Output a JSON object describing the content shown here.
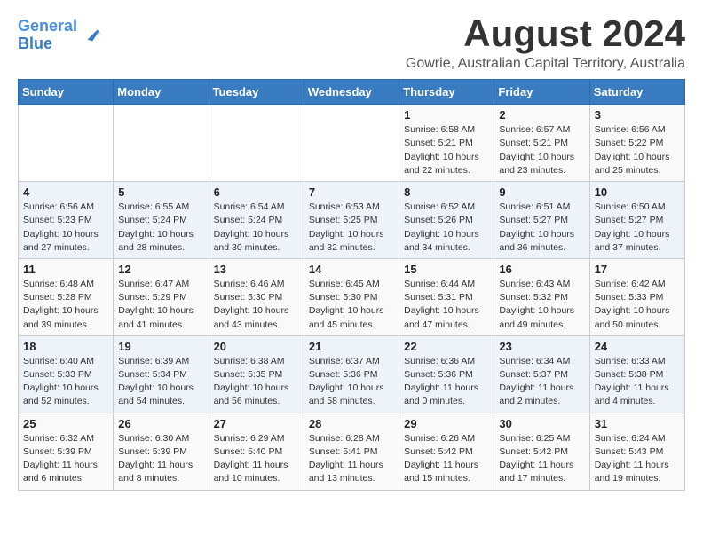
{
  "logo": {
    "line1": "General",
    "line2": "Blue"
  },
  "title": "August 2024",
  "location": "Gowrie, Australian Capital Territory, Australia",
  "weekdays": [
    "Sunday",
    "Monday",
    "Tuesday",
    "Wednesday",
    "Thursday",
    "Friday",
    "Saturday"
  ],
  "weeks": [
    [
      {
        "day": "",
        "info": ""
      },
      {
        "day": "",
        "info": ""
      },
      {
        "day": "",
        "info": ""
      },
      {
        "day": "",
        "info": ""
      },
      {
        "day": "1",
        "info": "Sunrise: 6:58 AM\nSunset: 5:21 PM\nDaylight: 10 hours\nand 22 minutes."
      },
      {
        "day": "2",
        "info": "Sunrise: 6:57 AM\nSunset: 5:21 PM\nDaylight: 10 hours\nand 23 minutes."
      },
      {
        "day": "3",
        "info": "Sunrise: 6:56 AM\nSunset: 5:22 PM\nDaylight: 10 hours\nand 25 minutes."
      }
    ],
    [
      {
        "day": "4",
        "info": "Sunrise: 6:56 AM\nSunset: 5:23 PM\nDaylight: 10 hours\nand 27 minutes."
      },
      {
        "day": "5",
        "info": "Sunrise: 6:55 AM\nSunset: 5:24 PM\nDaylight: 10 hours\nand 28 minutes."
      },
      {
        "day": "6",
        "info": "Sunrise: 6:54 AM\nSunset: 5:24 PM\nDaylight: 10 hours\nand 30 minutes."
      },
      {
        "day": "7",
        "info": "Sunrise: 6:53 AM\nSunset: 5:25 PM\nDaylight: 10 hours\nand 32 minutes."
      },
      {
        "day": "8",
        "info": "Sunrise: 6:52 AM\nSunset: 5:26 PM\nDaylight: 10 hours\nand 34 minutes."
      },
      {
        "day": "9",
        "info": "Sunrise: 6:51 AM\nSunset: 5:27 PM\nDaylight: 10 hours\nand 36 minutes."
      },
      {
        "day": "10",
        "info": "Sunrise: 6:50 AM\nSunset: 5:27 PM\nDaylight: 10 hours\nand 37 minutes."
      }
    ],
    [
      {
        "day": "11",
        "info": "Sunrise: 6:48 AM\nSunset: 5:28 PM\nDaylight: 10 hours\nand 39 minutes."
      },
      {
        "day": "12",
        "info": "Sunrise: 6:47 AM\nSunset: 5:29 PM\nDaylight: 10 hours\nand 41 minutes."
      },
      {
        "day": "13",
        "info": "Sunrise: 6:46 AM\nSunset: 5:30 PM\nDaylight: 10 hours\nand 43 minutes."
      },
      {
        "day": "14",
        "info": "Sunrise: 6:45 AM\nSunset: 5:30 PM\nDaylight: 10 hours\nand 45 minutes."
      },
      {
        "day": "15",
        "info": "Sunrise: 6:44 AM\nSunset: 5:31 PM\nDaylight: 10 hours\nand 47 minutes."
      },
      {
        "day": "16",
        "info": "Sunrise: 6:43 AM\nSunset: 5:32 PM\nDaylight: 10 hours\nand 49 minutes."
      },
      {
        "day": "17",
        "info": "Sunrise: 6:42 AM\nSunset: 5:33 PM\nDaylight: 10 hours\nand 50 minutes."
      }
    ],
    [
      {
        "day": "18",
        "info": "Sunrise: 6:40 AM\nSunset: 5:33 PM\nDaylight: 10 hours\nand 52 minutes."
      },
      {
        "day": "19",
        "info": "Sunrise: 6:39 AM\nSunset: 5:34 PM\nDaylight: 10 hours\nand 54 minutes."
      },
      {
        "day": "20",
        "info": "Sunrise: 6:38 AM\nSunset: 5:35 PM\nDaylight: 10 hours\nand 56 minutes."
      },
      {
        "day": "21",
        "info": "Sunrise: 6:37 AM\nSunset: 5:36 PM\nDaylight: 10 hours\nand 58 minutes."
      },
      {
        "day": "22",
        "info": "Sunrise: 6:36 AM\nSunset: 5:36 PM\nDaylight: 11 hours\nand 0 minutes."
      },
      {
        "day": "23",
        "info": "Sunrise: 6:34 AM\nSunset: 5:37 PM\nDaylight: 11 hours\nand 2 minutes."
      },
      {
        "day": "24",
        "info": "Sunrise: 6:33 AM\nSunset: 5:38 PM\nDaylight: 11 hours\nand 4 minutes."
      }
    ],
    [
      {
        "day": "25",
        "info": "Sunrise: 6:32 AM\nSunset: 5:39 PM\nDaylight: 11 hours\nand 6 minutes."
      },
      {
        "day": "26",
        "info": "Sunrise: 6:30 AM\nSunset: 5:39 PM\nDaylight: 11 hours\nand 8 minutes."
      },
      {
        "day": "27",
        "info": "Sunrise: 6:29 AM\nSunset: 5:40 PM\nDaylight: 11 hours\nand 10 minutes."
      },
      {
        "day": "28",
        "info": "Sunrise: 6:28 AM\nSunset: 5:41 PM\nDaylight: 11 hours\nand 13 minutes."
      },
      {
        "day": "29",
        "info": "Sunrise: 6:26 AM\nSunset: 5:42 PM\nDaylight: 11 hours\nand 15 minutes."
      },
      {
        "day": "30",
        "info": "Sunrise: 6:25 AM\nSunset: 5:42 PM\nDaylight: 11 hours\nand 17 minutes."
      },
      {
        "day": "31",
        "info": "Sunrise: 6:24 AM\nSunset: 5:43 PM\nDaylight: 11 hours\nand 19 minutes."
      }
    ]
  ]
}
